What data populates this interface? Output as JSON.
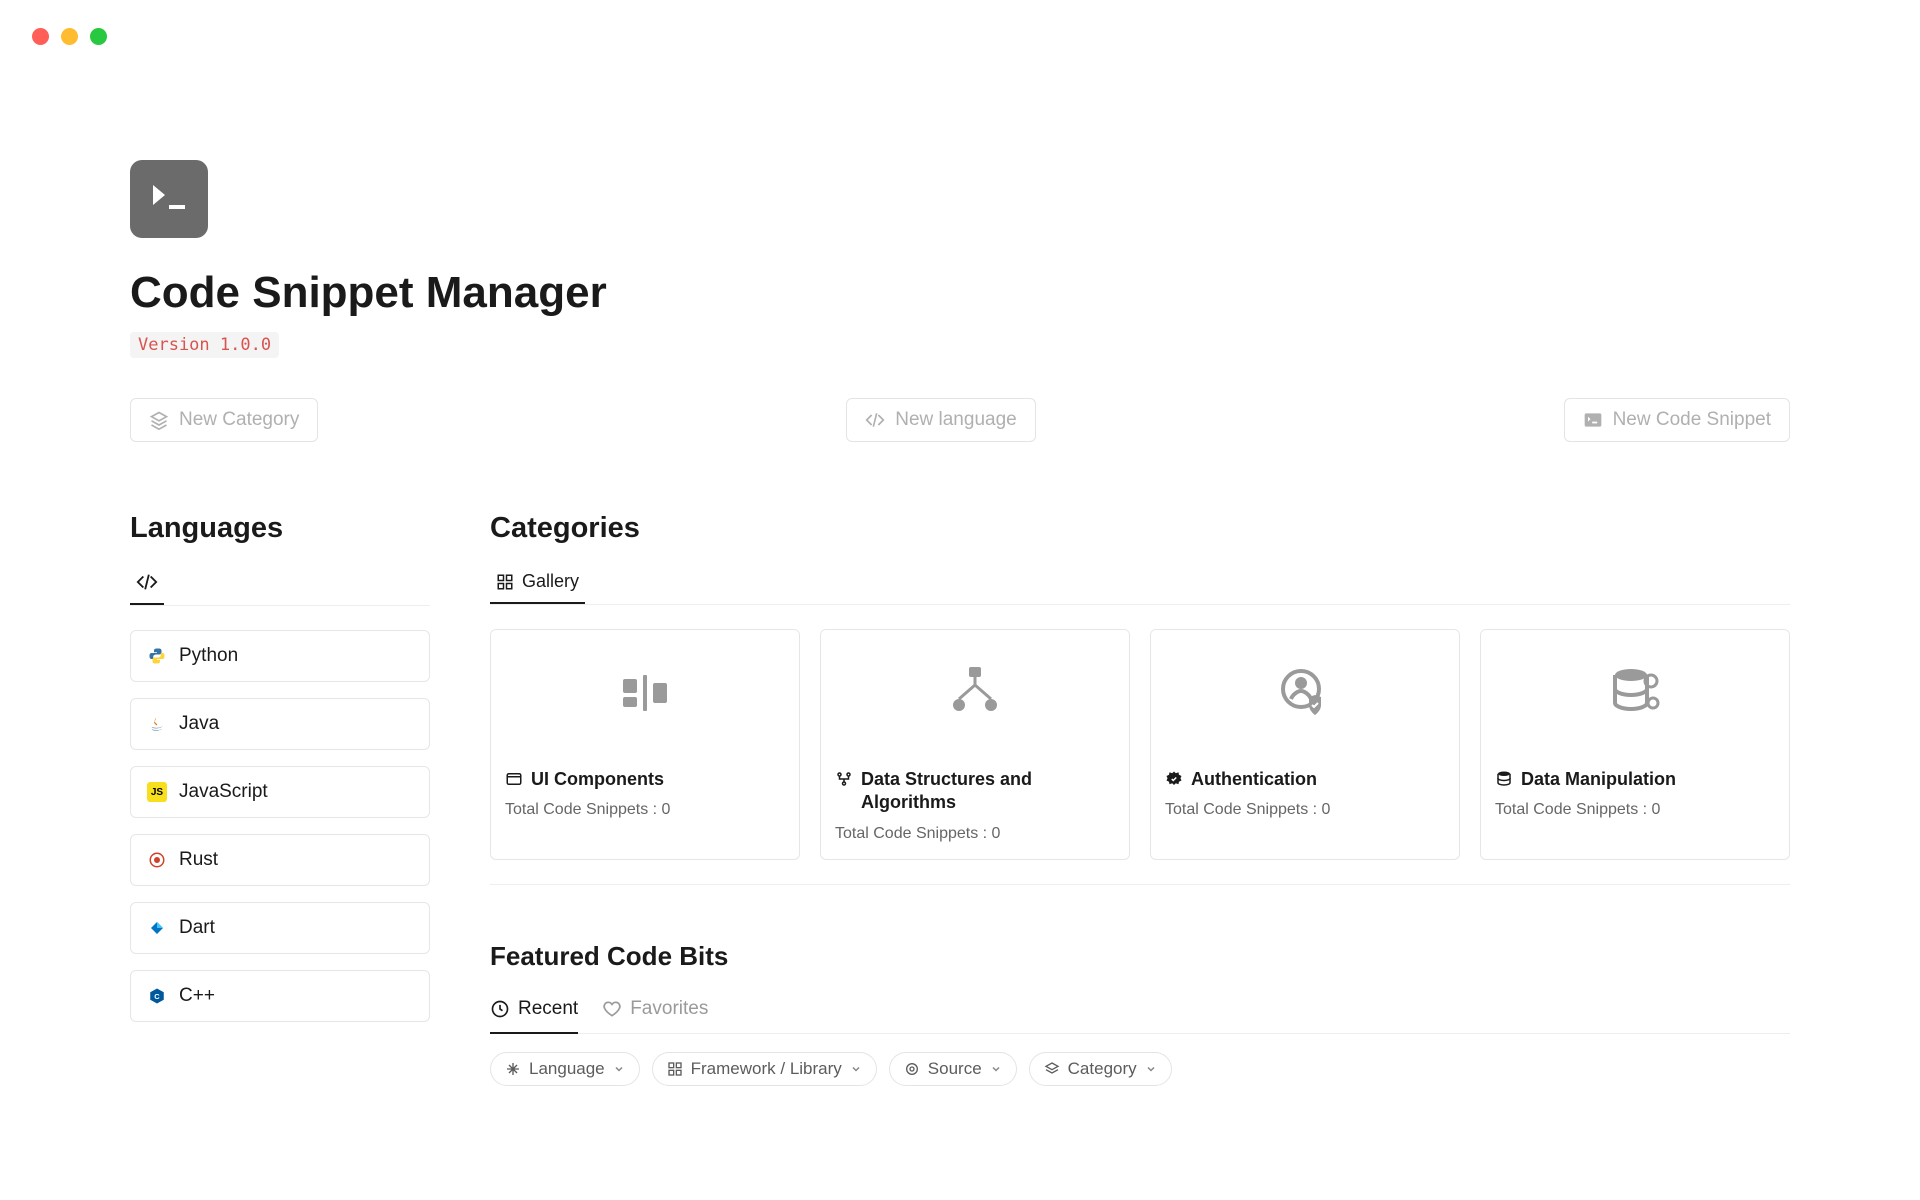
{
  "page": {
    "title": "Code Snippet Manager",
    "version": "Version 1.0.0"
  },
  "actions": {
    "new_category": "New Category",
    "new_language": "New language",
    "new_snippet": "New Code Snippet"
  },
  "languages": {
    "title": "Languages",
    "items": [
      {
        "label": "Python",
        "icon": "python-icon"
      },
      {
        "label": "Java",
        "icon": "java-icon"
      },
      {
        "label": "JavaScript",
        "icon": "js-icon"
      },
      {
        "label": "Rust",
        "icon": "rust-icon"
      },
      {
        "label": "Dart",
        "icon": "dart-icon"
      },
      {
        "label": "C++",
        "icon": "cpp-icon"
      }
    ]
  },
  "categories": {
    "title": "Categories",
    "tab": "Gallery",
    "items": [
      {
        "label": "UI Components",
        "meta": "Total Code Snippets : 0",
        "icon": "ui-components-icon"
      },
      {
        "label": "Data Structures and Algorithms",
        "meta": "Total Code Snippets : 0",
        "icon": "algorithm-icon"
      },
      {
        "label": "Authentication",
        "meta": "Total Code Snippets : 0",
        "icon": "auth-icon"
      },
      {
        "label": "Data Manipulation",
        "meta": "Total Code Snippets : 0",
        "icon": "database-icon"
      }
    ]
  },
  "featured": {
    "title": "Featured Code Bits",
    "tabs": {
      "recent": "Recent",
      "favorites": "Favorites"
    },
    "filters": [
      {
        "label": "Language",
        "icon": "sparkle-icon"
      },
      {
        "label": "Framework / Library",
        "icon": "grid-icon"
      },
      {
        "label": "Source",
        "icon": "target-icon"
      },
      {
        "label": "Category",
        "icon": "layers-icon"
      }
    ]
  }
}
